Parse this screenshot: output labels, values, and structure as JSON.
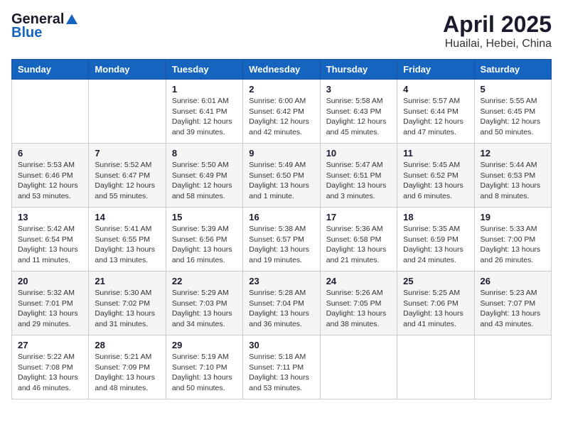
{
  "header": {
    "logo_general": "General",
    "logo_blue": "Blue",
    "month_title": "April 2025",
    "location": "Huailai, Hebei, China"
  },
  "weekdays": [
    "Sunday",
    "Monday",
    "Tuesday",
    "Wednesday",
    "Thursday",
    "Friday",
    "Saturday"
  ],
  "weeks": [
    [
      {
        "day": "",
        "sunrise": "",
        "sunset": "",
        "daylight": ""
      },
      {
        "day": "",
        "sunrise": "",
        "sunset": "",
        "daylight": ""
      },
      {
        "day": "1",
        "sunrise": "Sunrise: 6:01 AM",
        "sunset": "Sunset: 6:41 PM",
        "daylight": "Daylight: 12 hours and 39 minutes."
      },
      {
        "day": "2",
        "sunrise": "Sunrise: 6:00 AM",
        "sunset": "Sunset: 6:42 PM",
        "daylight": "Daylight: 12 hours and 42 minutes."
      },
      {
        "day": "3",
        "sunrise": "Sunrise: 5:58 AM",
        "sunset": "Sunset: 6:43 PM",
        "daylight": "Daylight: 12 hours and 45 minutes."
      },
      {
        "day": "4",
        "sunrise": "Sunrise: 5:57 AM",
        "sunset": "Sunset: 6:44 PM",
        "daylight": "Daylight: 12 hours and 47 minutes."
      },
      {
        "day": "5",
        "sunrise": "Sunrise: 5:55 AM",
        "sunset": "Sunset: 6:45 PM",
        "daylight": "Daylight: 12 hours and 50 minutes."
      }
    ],
    [
      {
        "day": "6",
        "sunrise": "Sunrise: 5:53 AM",
        "sunset": "Sunset: 6:46 PM",
        "daylight": "Daylight: 12 hours and 53 minutes."
      },
      {
        "day": "7",
        "sunrise": "Sunrise: 5:52 AM",
        "sunset": "Sunset: 6:47 PM",
        "daylight": "Daylight: 12 hours and 55 minutes."
      },
      {
        "day": "8",
        "sunrise": "Sunrise: 5:50 AM",
        "sunset": "Sunset: 6:49 PM",
        "daylight": "Daylight: 12 hours and 58 minutes."
      },
      {
        "day": "9",
        "sunrise": "Sunrise: 5:49 AM",
        "sunset": "Sunset: 6:50 PM",
        "daylight": "Daylight: 13 hours and 1 minute."
      },
      {
        "day": "10",
        "sunrise": "Sunrise: 5:47 AM",
        "sunset": "Sunset: 6:51 PM",
        "daylight": "Daylight: 13 hours and 3 minutes."
      },
      {
        "day": "11",
        "sunrise": "Sunrise: 5:45 AM",
        "sunset": "Sunset: 6:52 PM",
        "daylight": "Daylight: 13 hours and 6 minutes."
      },
      {
        "day": "12",
        "sunrise": "Sunrise: 5:44 AM",
        "sunset": "Sunset: 6:53 PM",
        "daylight": "Daylight: 13 hours and 8 minutes."
      }
    ],
    [
      {
        "day": "13",
        "sunrise": "Sunrise: 5:42 AM",
        "sunset": "Sunset: 6:54 PM",
        "daylight": "Daylight: 13 hours and 11 minutes."
      },
      {
        "day": "14",
        "sunrise": "Sunrise: 5:41 AM",
        "sunset": "Sunset: 6:55 PM",
        "daylight": "Daylight: 13 hours and 13 minutes."
      },
      {
        "day": "15",
        "sunrise": "Sunrise: 5:39 AM",
        "sunset": "Sunset: 6:56 PM",
        "daylight": "Daylight: 13 hours and 16 minutes."
      },
      {
        "day": "16",
        "sunrise": "Sunrise: 5:38 AM",
        "sunset": "Sunset: 6:57 PM",
        "daylight": "Daylight: 13 hours and 19 minutes."
      },
      {
        "day": "17",
        "sunrise": "Sunrise: 5:36 AM",
        "sunset": "Sunset: 6:58 PM",
        "daylight": "Daylight: 13 hours and 21 minutes."
      },
      {
        "day": "18",
        "sunrise": "Sunrise: 5:35 AM",
        "sunset": "Sunset: 6:59 PM",
        "daylight": "Daylight: 13 hours and 24 minutes."
      },
      {
        "day": "19",
        "sunrise": "Sunrise: 5:33 AM",
        "sunset": "Sunset: 7:00 PM",
        "daylight": "Daylight: 13 hours and 26 minutes."
      }
    ],
    [
      {
        "day": "20",
        "sunrise": "Sunrise: 5:32 AM",
        "sunset": "Sunset: 7:01 PM",
        "daylight": "Daylight: 13 hours and 29 minutes."
      },
      {
        "day": "21",
        "sunrise": "Sunrise: 5:30 AM",
        "sunset": "Sunset: 7:02 PM",
        "daylight": "Daylight: 13 hours and 31 minutes."
      },
      {
        "day": "22",
        "sunrise": "Sunrise: 5:29 AM",
        "sunset": "Sunset: 7:03 PM",
        "daylight": "Daylight: 13 hours and 34 minutes."
      },
      {
        "day": "23",
        "sunrise": "Sunrise: 5:28 AM",
        "sunset": "Sunset: 7:04 PM",
        "daylight": "Daylight: 13 hours and 36 minutes."
      },
      {
        "day": "24",
        "sunrise": "Sunrise: 5:26 AM",
        "sunset": "Sunset: 7:05 PM",
        "daylight": "Daylight: 13 hours and 38 minutes."
      },
      {
        "day": "25",
        "sunrise": "Sunrise: 5:25 AM",
        "sunset": "Sunset: 7:06 PM",
        "daylight": "Daylight: 13 hours and 41 minutes."
      },
      {
        "day": "26",
        "sunrise": "Sunrise: 5:23 AM",
        "sunset": "Sunset: 7:07 PM",
        "daylight": "Daylight: 13 hours and 43 minutes."
      }
    ],
    [
      {
        "day": "27",
        "sunrise": "Sunrise: 5:22 AM",
        "sunset": "Sunset: 7:08 PM",
        "daylight": "Daylight: 13 hours and 46 minutes."
      },
      {
        "day": "28",
        "sunrise": "Sunrise: 5:21 AM",
        "sunset": "Sunset: 7:09 PM",
        "daylight": "Daylight: 13 hours and 48 minutes."
      },
      {
        "day": "29",
        "sunrise": "Sunrise: 5:19 AM",
        "sunset": "Sunset: 7:10 PM",
        "daylight": "Daylight: 13 hours and 50 minutes."
      },
      {
        "day": "30",
        "sunrise": "Sunrise: 5:18 AM",
        "sunset": "Sunset: 7:11 PM",
        "daylight": "Daylight: 13 hours and 53 minutes."
      },
      {
        "day": "",
        "sunrise": "",
        "sunset": "",
        "daylight": ""
      },
      {
        "day": "",
        "sunrise": "",
        "sunset": "",
        "daylight": ""
      },
      {
        "day": "",
        "sunrise": "",
        "sunset": "",
        "daylight": ""
      }
    ]
  ]
}
